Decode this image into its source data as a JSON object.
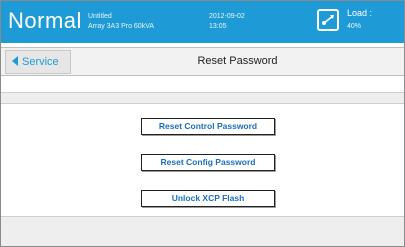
{
  "header": {
    "mode": "Normal",
    "title": "Untitled",
    "model": "Array 3A3 Pro 60kVA",
    "date": "2012-09-02",
    "time": "13:05",
    "load_label": "Load :",
    "load_value": "40%",
    "load_icon": "load-meter-icon"
  },
  "nav": {
    "back_label": "Service",
    "back_icon": "triangle-left-icon",
    "page_title": "Reset Password"
  },
  "actions": {
    "reset_control": "Reset Control Password",
    "reset_config": "Reset Config Password",
    "unlock_xcp": "Unlock XCP Flash"
  },
  "colors": {
    "accent": "#1e9bd7",
    "button_text": "#1a6fb8"
  }
}
